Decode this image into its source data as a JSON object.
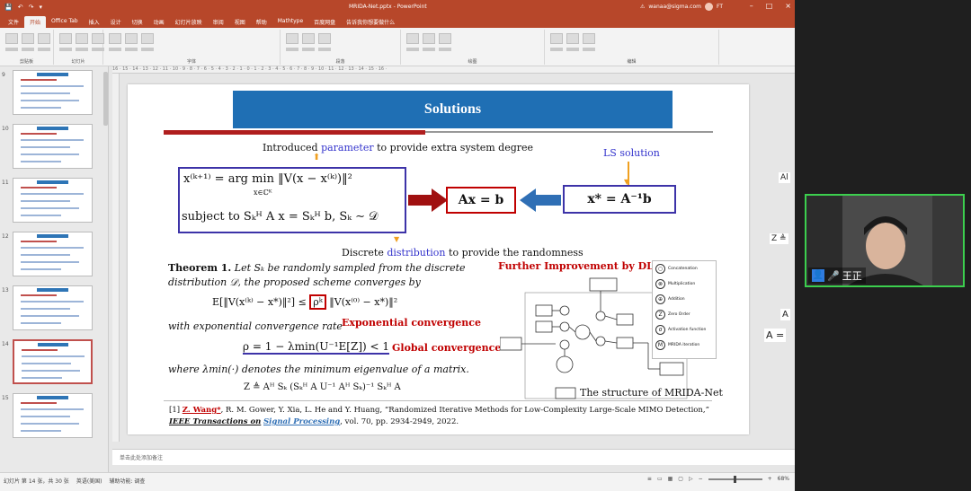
{
  "window": {
    "title": "MRIDA-Net.pptx - PowerPoint",
    "account": "wanaa@sigma.com",
    "initials": "FT"
  },
  "ribbon_tabs": [
    "文件",
    "开始",
    "Office Tab",
    "插入",
    "设计",
    "切换",
    "动画",
    "幻灯片放映",
    "审阅",
    "视图",
    "帮助",
    "Mathtype",
    "百度网盘",
    "告诉我你想要做什么"
  ],
  "ribbon_groups": [
    "剪贴板",
    "幻灯片",
    "字体",
    "段落",
    "绘图",
    "编辑"
  ],
  "slide_numbers": [
    "9",
    "10",
    "11",
    "12",
    "13",
    "14",
    "15"
  ],
  "slide": {
    "title": "Solutions",
    "intro_pre": "Introduced ",
    "intro_param": "parameter",
    "intro_post": " to provide extra system degree",
    "ls_solution": "LS solution",
    "eq_left_1": "x⁽ᵏ⁺¹⁾ = arg min ‖V(x − x⁽ᵏ⁾)‖²",
    "eq_left_1_sub": "x∈ℂᴷ",
    "eq_left_2": "subject to Sₖᴴ A x = Sₖᴴ b,  Sₖ ∼ 𝒟",
    "eq_mid": "Ax = b",
    "eq_right": "x* = A⁻¹b",
    "disc_pre": "Discrete ",
    "disc_dist": "distribution",
    "disc_post": " to provide the randomness",
    "theorem_head": "Theorem 1.",
    "theorem_text_1": " Let Sₖ be randomly sampled from the discrete",
    "theorem_text_2": "distribution 𝒟, the proposed scheme converges by",
    "theorem_eq": "E[‖V(x⁽ᵏ⁾ − x*)‖²] ≤",
    "theorem_rho": "ρᵏ",
    "theorem_eq_tail": "‖V(x⁽⁰⁾ − x*)‖²",
    "exp_rate": "with exponential convergence rate",
    "exp_conv": "Exponential convergence",
    "rho_def": "ρ = 1 − λmin(U⁻¹E[Z]) < 1",
    "global_conv": "Global convergence",
    "where_text": "where λmin(·) denotes the minimum eigenvalue of a matrix.",
    "z_def": "Z ≜ Aᴴ Sₖ (Sₖᴴ A U⁻¹ Aᴴ Sₖ)⁻¹ Sₖᴴ A",
    "further": "Further Improvement by DL",
    "structure_label": "The structure of MRIDA-Net",
    "ref_1_num": "[1] ",
    "ref_1_author": "Z. Wang*",
    "ref_1_rest": ", R. M. Gower, Y. Xia, L. He and Y. Huang, “Randomized Iterative Methods for Low-Complexity Large-Scale MIMO Detection,”",
    "ref_2_journal": "IEEE Transactions on",
    "ref_2_sp": "Signal Processing",
    "ref_2_rest": ", vol. 70, pp. 2934-2949, 2022."
  },
  "legend": [
    "Concatenation",
    "Multiplication",
    "Addition",
    "Zero Order",
    "Activation function",
    "MRIDA iteration"
  ],
  "notes": "单击此处添加备注",
  "status": {
    "slide": "幻灯片 第 14 张，共 30 张",
    "lang": "英语(美国)",
    "access": "辅助功能: 调查",
    "zoom": "68%"
  },
  "right_edge": [
    "Al",
    "Z ≜",
    "A",
    "A ="
  ],
  "webcam": {
    "name": "王正"
  },
  "colors": {
    "ppt_red": "#b7472a",
    "title_blue": "#1f6fb4",
    "box_purple": "#3d33a8",
    "accent_red": "#c00000",
    "webcam_border": "#3ccf4e"
  }
}
